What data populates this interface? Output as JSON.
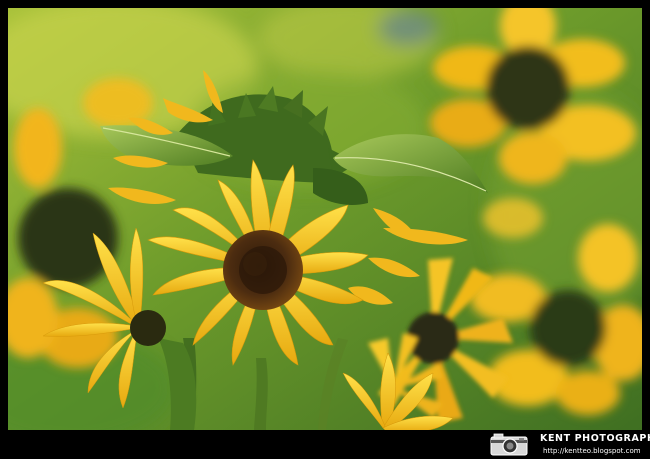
{
  "watermark": {
    "brand": "KENT PHOTOGRAPHY",
    "url": "http://kentteo.blogspot.com",
    "icon": "camera-icon"
  },
  "colors": {
    "frame": "#000000",
    "petal": "#f2c21a",
    "petal_light": "#ffd93a",
    "seed_head": "#4a2a10",
    "foliage": "#5e8f2a",
    "background_glow": "#c9d24a"
  }
}
